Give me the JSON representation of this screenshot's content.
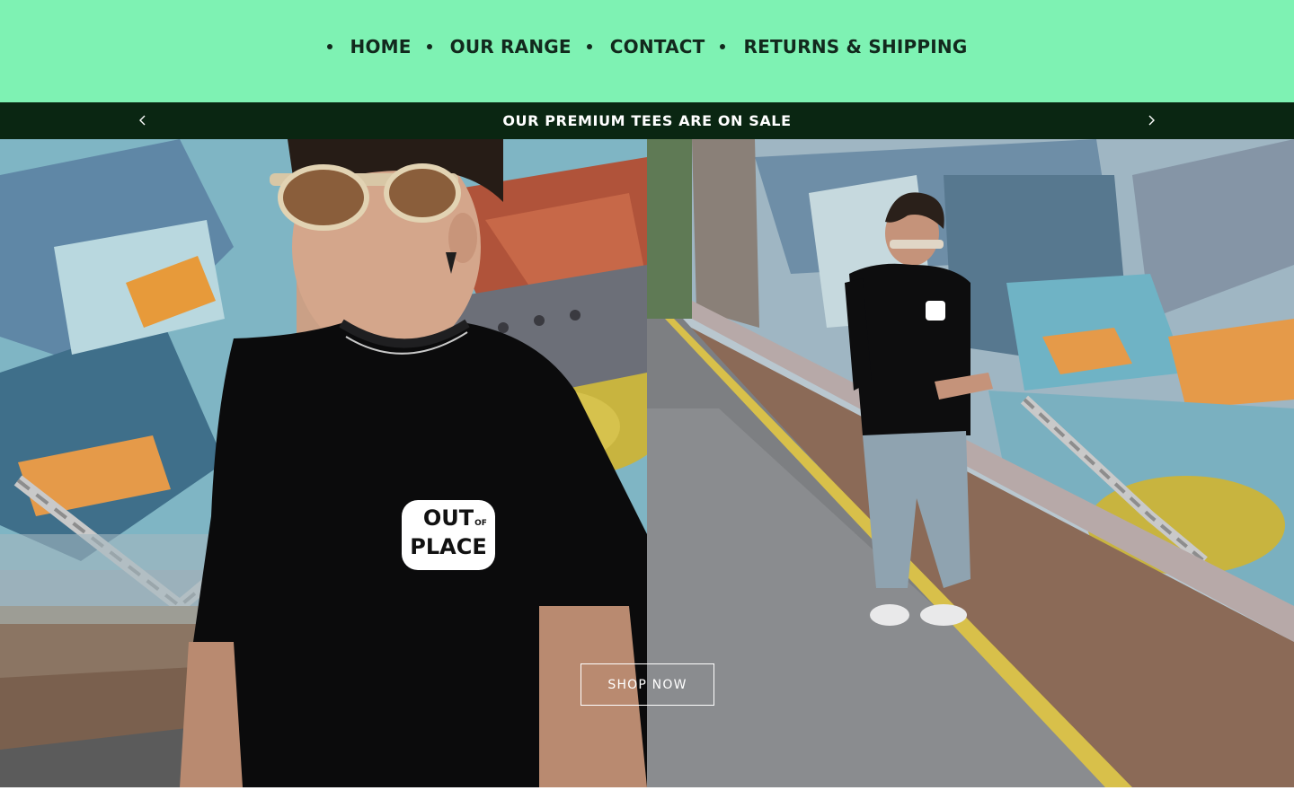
{
  "nav": {
    "items": [
      {
        "label": "HOME"
      },
      {
        "label": "OUR RANGE"
      },
      {
        "label": "CONTACT"
      },
      {
        "label": "RETURNS & SHIPPING"
      }
    ]
  },
  "announcement": {
    "text": "OUR PREMIUM TEES ARE ON SALE",
    "prev_icon": "chevron-left-icon",
    "next_icon": "chevron-right-icon"
  },
  "hero": {
    "button_label": "SHOP NOW",
    "left_image": "man-in-black-tee-closeup-graffiti-wall",
    "right_image": "man-walking-beside-graffiti-wall",
    "shirt_logo": {
      "line1": "OUT",
      "line2": "OF",
      "line3": "PLACE"
    }
  },
  "colors": {
    "header_bg": "#7ef2b3",
    "nav_text": "#12291d",
    "announce_bg": "#0a2612",
    "announce_text": "#ffffff"
  }
}
